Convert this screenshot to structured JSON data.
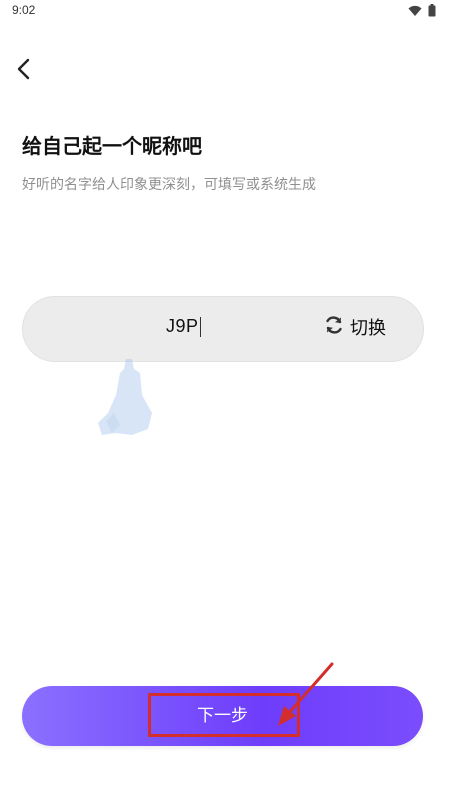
{
  "status_bar": {
    "time": "9:02",
    "icons": [
      "wifi-icon",
      "battery-icon"
    ]
  },
  "header": {
    "back_icon": "chevron-left-icon"
  },
  "main": {
    "title": "给自己起一个昵称吧",
    "subtitle": "好听的名字给人印象更深刻，可填写或系统生成",
    "nickname_value": "J9P",
    "switch_label": "切换",
    "switch_icon": "refresh-icon"
  },
  "footer": {
    "next_label": "下一步"
  },
  "colors": {
    "primary_gradient_start": "#8a70ff",
    "primary_gradient_end": "#6e3dfb",
    "annotation_red": "#d32d2d",
    "field_bg": "#ececec",
    "subtitle_gray": "#8f8f8f"
  }
}
